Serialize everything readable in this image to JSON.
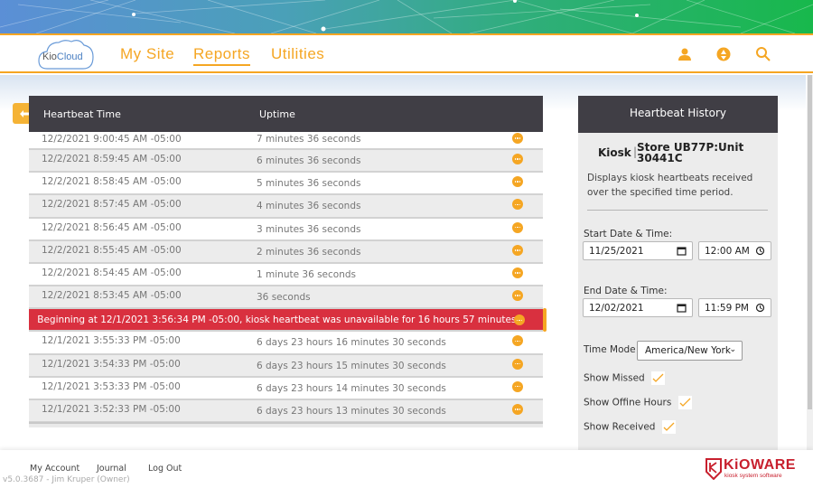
{
  "app": {
    "logo_text_a": "Kio",
    "logo_text_b": "Cloud"
  },
  "nav": {
    "items": [
      {
        "label": "My Site",
        "active": false
      },
      {
        "label": "Reports",
        "active": true
      },
      {
        "label": "Utilities",
        "active": false
      }
    ],
    "icons": [
      "user-icon",
      "recycle-icon",
      "search-icon"
    ],
    "accent": "#f5a623"
  },
  "table": {
    "columns": [
      "Heartbeat Time",
      "Uptime"
    ],
    "rows_before_gap": [
      {
        "time": "12/2/2021 9:00:45 AM -05:00",
        "uptime": "7 minutes 36 seconds"
      },
      {
        "time": "12/2/2021 8:59:45 AM -05:00",
        "uptime": "6 minutes 36 seconds"
      },
      {
        "time": "12/2/2021 8:58:45 AM -05:00",
        "uptime": "5 minutes 36 seconds"
      },
      {
        "time": "12/2/2021 8:57:45 AM -05:00",
        "uptime": "4 minutes 36 seconds"
      },
      {
        "time": "12/2/2021 8:56:45 AM -05:00",
        "uptime": "3 minutes 36 seconds"
      },
      {
        "time": "12/2/2021 8:55:45 AM -05:00",
        "uptime": "2 minutes 36 seconds"
      },
      {
        "time": "12/2/2021 8:54:45 AM -05:00",
        "uptime": "1 minute 36 seconds"
      },
      {
        "time": "12/2/2021 8:53:45 AM -05:00",
        "uptime": "36 seconds"
      }
    ],
    "gap_message": "Beginning at 12/1/2021 3:56:34 PM -05:00, kiosk heartbeat was unavailable for 16 hours 57 minutes.",
    "gap_color": "#d9303f",
    "rows_after_gap": [
      {
        "time": "12/1/2021 3:55:33 PM -05:00",
        "uptime": "6 days 23 hours 16 minutes 30 seconds"
      },
      {
        "time": "12/1/2021 3:54:33 PM -05:00",
        "uptime": "6 days 23 hours 15 minutes 30 seconds"
      },
      {
        "time": "12/1/2021 3:53:33 PM -05:00",
        "uptime": "6 days 23 hours 14 minutes 30 seconds"
      },
      {
        "time": "12/1/2021 3:52:33 PM -05:00",
        "uptime": "6 days 23 hours 13 minutes 30 seconds"
      }
    ]
  },
  "panel": {
    "title": "Heartbeat History",
    "kiosk_label": "Kiosk",
    "separator": "|",
    "kiosk_name": "Store UB77P:Unit 30441C",
    "description": "Displays kiosk heartbeats received over the specified time period.",
    "start_label": "Start Date & Time:",
    "start_date": "11/25/2021",
    "start_time": "12:00 AM",
    "end_label": "End Date & Time:",
    "end_date": "12/02/2021",
    "end_time": "11:59 PM",
    "time_mode_label": "Time Mode",
    "time_mode_value": "America/New York",
    "checks": [
      {
        "label": "Show Missed",
        "checked": true
      },
      {
        "label": "Show Offine Hours",
        "checked": true
      },
      {
        "label": "Show Received",
        "checked": true
      }
    ]
  },
  "footer": {
    "links": [
      "My Account",
      "Journal",
      "Log Out"
    ],
    "version": "v5.0.3687 - Jim Kruper (Owner)",
    "brand": "KiOWARE",
    "brand_sub": "kiosk system software",
    "brand_color": "#c8202e"
  }
}
